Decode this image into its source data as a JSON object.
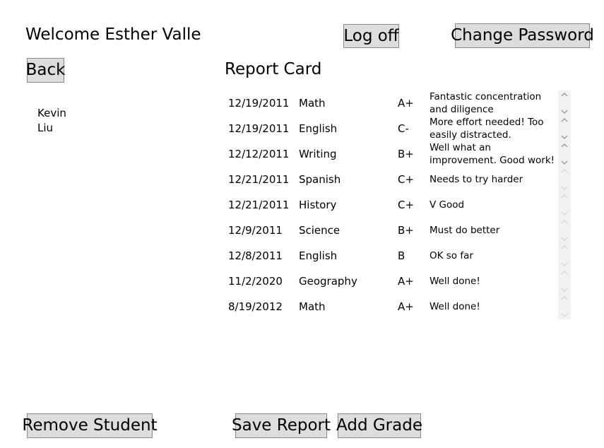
{
  "header": {
    "welcome": "Welcome Esther Valle",
    "logoff_label": "Log off",
    "change_password_label": "Change Password"
  },
  "nav": {
    "back_label": "Back"
  },
  "students": [
    {
      "first": "Kevin",
      "last": "Liu"
    }
  ],
  "report": {
    "title": "Report Card",
    "rows": [
      {
        "date": "12/19/2011",
        "subject": "Math",
        "grade": "A+",
        "comment": "Fantastic concentration and diligence"
      },
      {
        "date": "12/19/2011",
        "subject": "English",
        "grade": "C-",
        "comment": "More effort needed! Too easily distracted."
      },
      {
        "date": "12/12/2011",
        "subject": "Writing",
        "grade": "B+",
        "comment": "Well what an improvement. Good work!"
      },
      {
        "date": "12/21/2011",
        "subject": "Spanish",
        "grade": "C+",
        "comment": "Needs to try harder"
      },
      {
        "date": "12/21/2011",
        "subject": "History",
        "grade": "C+",
        "comment": "V Good"
      },
      {
        "date": "12/9/2011",
        "subject": "Science",
        "grade": "B+",
        "comment": "Must do better"
      },
      {
        "date": "12/8/2011",
        "subject": "English",
        "grade": "B",
        "comment": "OK so far"
      },
      {
        "date": "11/2/2020",
        "subject": "Geography",
        "grade": "A+",
        "comment": "Well done!"
      },
      {
        "date": "8/19/2012",
        "subject": "Math",
        "grade": "A+",
        "comment": "Well done!"
      }
    ]
  },
  "footer": {
    "remove_student_label": "Remove Student",
    "save_report_label": "Save Report",
    "add_grade_label": "Add Grade"
  }
}
